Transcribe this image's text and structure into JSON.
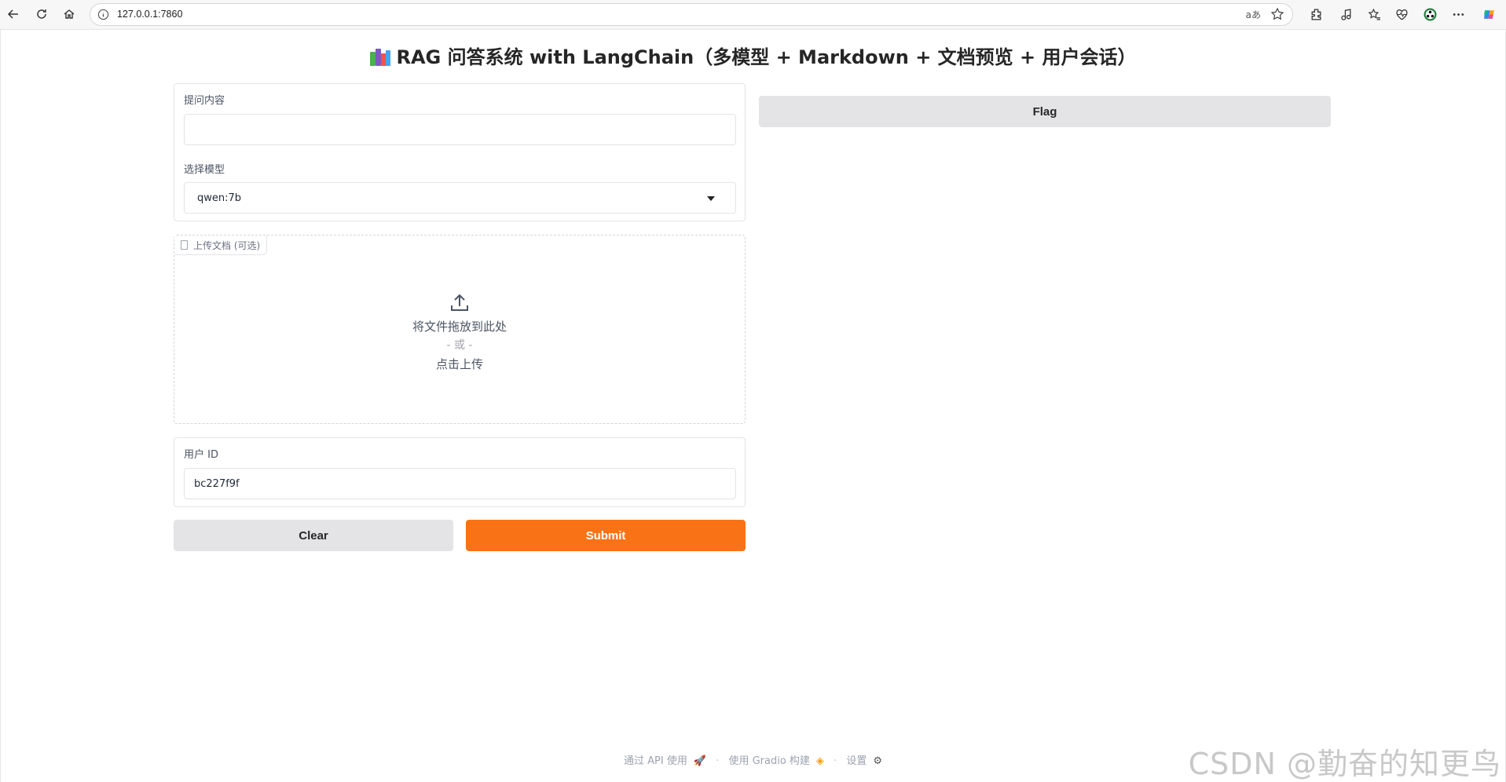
{
  "browser": {
    "url": "127.0.0.1:7860"
  },
  "app": {
    "title": "RAG 问答系统 with LangChain（多模型 + Markdown + 文档预览 + 用户会话）"
  },
  "form": {
    "question_label": "提问内容",
    "question_value": "",
    "model_label": "选择模型",
    "model_value": "qwen:7b",
    "upload_label": "上传文档 (可选)",
    "upload_drop": "将文件拖放到此处",
    "upload_or": "- 或 -",
    "upload_click": "点击上传",
    "user_id_label": "用户 ID",
    "user_id_value": "bc227f9f"
  },
  "buttons": {
    "clear": "Clear",
    "submit": "Submit",
    "flag": "Flag"
  },
  "footer": {
    "api": "通过 API 使用",
    "built": "使用 Gradio 构建",
    "settings": "设置"
  },
  "watermark": "CSDN @勤奋的知更鸟",
  "colors": {
    "accent": "#f97316",
    "secondary_button": "#e4e4e7"
  }
}
